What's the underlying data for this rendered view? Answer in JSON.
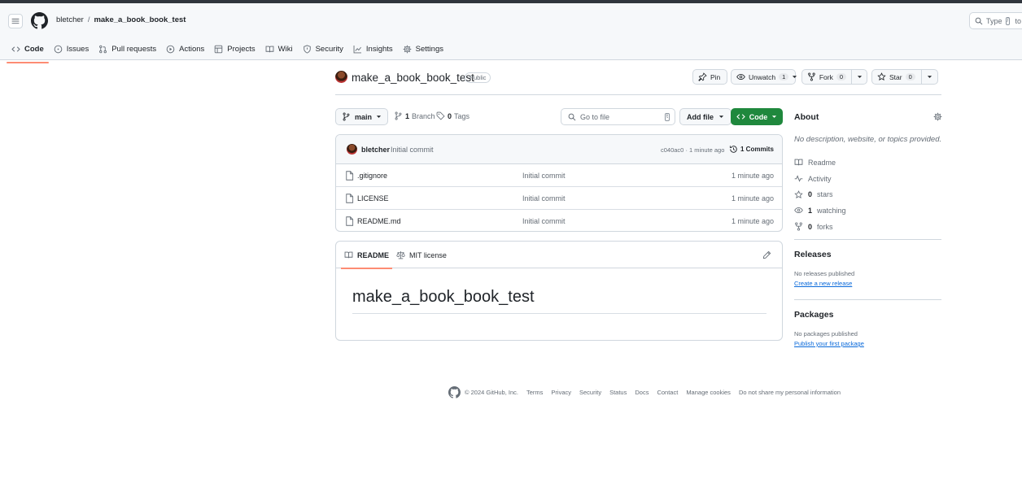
{
  "header": {
    "owner": "bletcher",
    "separator": "/",
    "repo": "make_a_book_book_test",
    "search": {
      "prefix": "Type",
      "key": "/",
      "suffix": "to se"
    }
  },
  "nav": {
    "code": "Code",
    "issues": "Issues",
    "pulls": "Pull requests",
    "actions": "Actions",
    "projects": "Projects",
    "wiki": "Wiki",
    "security": "Security",
    "insights": "Insights",
    "settings": "Settings"
  },
  "repo": {
    "name": "make_a_book_book_test",
    "visibility": "Public",
    "pin": "Pin",
    "unwatch": "Unwatch",
    "watch_count": "1",
    "fork": "Fork",
    "fork_count": "0",
    "star": "Star",
    "star_count": "0"
  },
  "toolbar": {
    "branch": "main",
    "branches_count": "1",
    "branches_label": "Branch",
    "tags_count": "0",
    "tags_label": "Tags",
    "go_to_file": "Go to file",
    "go_key": "t",
    "add_file": "Add file",
    "code": "Code"
  },
  "commit": {
    "author": "bletcher",
    "message": "Initial commit",
    "sha_time": "c040ac0 · 1 minute ago",
    "commits": "1 Commits"
  },
  "files": [
    {
      "name": ".gitignore",
      "message": "Initial commit",
      "time": "1 minute ago"
    },
    {
      "name": "LICENSE",
      "message": "Initial commit",
      "time": "1 minute ago"
    },
    {
      "name": "README.md",
      "message": "Initial commit",
      "time": "1 minute ago"
    }
  ],
  "readme": {
    "tab_readme": "README",
    "tab_license": "MIT license",
    "heading": "make_a_book_book_test"
  },
  "about": {
    "title": "About",
    "description": "No description, website, or topics provided.",
    "readme": "Readme",
    "activity": "Activity",
    "stars_count": "0",
    "stars_label": "stars",
    "watching_count": "1",
    "watching_label": "watching",
    "forks_count": "0",
    "forks_label": "forks"
  },
  "releases": {
    "title": "Releases",
    "empty": "No releases published",
    "link": "Create a new release"
  },
  "packages": {
    "title": "Packages",
    "empty": "No packages published",
    "link": "Publish your first package"
  },
  "footer": {
    "copyright": "© 2024 GitHub, Inc.",
    "terms": "Terms",
    "privacy": "Privacy",
    "security": "Security",
    "status": "Status",
    "docs": "Docs",
    "contact": "Contact",
    "cookies": "Manage cookies",
    "noshare": "Do not share my personal information"
  },
  "colors": {
    "accent_green": "#1f883d",
    "link_blue": "#0969da",
    "tab_underline": "#fd8c73"
  }
}
